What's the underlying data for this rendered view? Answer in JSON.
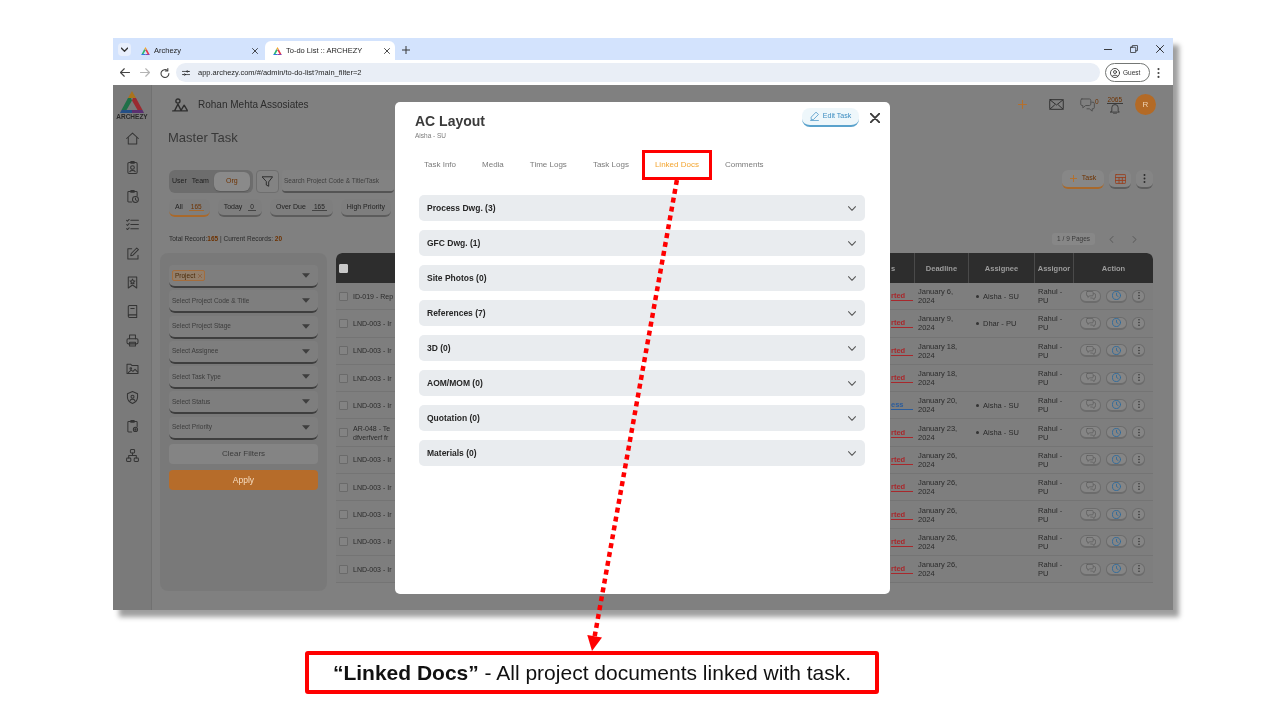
{
  "browser": {
    "tabs": [
      {
        "title": "Archezy",
        "selected": false
      },
      {
        "title": "To-do List :: ARCHEZY",
        "selected": true
      }
    ],
    "url": "app.archezy.com/#/admin/to-do-list?main_filter=2",
    "profile": "Guest"
  },
  "app": {
    "brand": "ARCHEZY",
    "company": "Rohan Mehta Assosiates",
    "chat_count": "0",
    "notification_count": "2065",
    "avatar": "R",
    "page_title": "Master Task",
    "scope": [
      {
        "label": "User",
        "selected": false
      },
      {
        "label": "Team",
        "selected": false
      },
      {
        "label": "Org",
        "selected": true
      }
    ],
    "search": {
      "placeholder": "Search Project Code & Title/Task"
    },
    "add_task": "Task",
    "quick_filters": [
      {
        "label": "All",
        "count": "165",
        "selected": true
      },
      {
        "label": "Today",
        "count": "0",
        "selected": false
      },
      {
        "label": "Over Due",
        "count": "165",
        "selected": false
      },
      {
        "label": "High Priority",
        "selected": false
      }
    ],
    "summary": {
      "total_label": "Total Record:",
      "total": "165",
      "current_label": "| Current Records:",
      "current": "20"
    },
    "pagination": "1 / 9 Pages",
    "filters": {
      "fields": [
        {
          "kind": "tags",
          "tags": [
            "Project"
          ]
        },
        {
          "kind": "select",
          "placeholder": "Select Project Code & Title"
        },
        {
          "kind": "select",
          "placeholder": "Select Project Stage"
        },
        {
          "kind": "select",
          "placeholder": "Select Assignee"
        },
        {
          "kind": "select",
          "placeholder": "Select Task Type"
        },
        {
          "kind": "select",
          "placeholder": "Select Status"
        },
        {
          "kind": "select",
          "placeholder": "Select Priority"
        }
      ],
      "clear": "Clear Filters",
      "apply": "Apply"
    },
    "table": {
      "select_all": {
        "checked": false
      },
      "columns": [
        "s",
        "Deadline",
        "Assignee",
        "Assignor",
        "Action"
      ],
      "rows": [
        {
          "checked": false,
          "title": "ID-019 - Rep",
          "status": {
            "text": "rted",
            "color": "#a8282c"
          },
          "deadline": "January 6, 2024",
          "assignees": [
            "Aisha - SU"
          ],
          "assignor": "Rahul - PU"
        },
        {
          "checked": false,
          "title": "LND-003 - Ir",
          "status": {
            "text": "rted",
            "color": "#a8282c"
          },
          "deadline": "January 9, 2024",
          "assignees": [
            "Dhar - PU"
          ],
          "assignor": "Rahul - PU"
        },
        {
          "checked": false,
          "title": "LND-003 - Ir",
          "status": {
            "text": "rted",
            "color": "#a8282c"
          },
          "deadline": "January 18, 2024",
          "assignor": "Rahul - PU"
        },
        {
          "checked": false,
          "title": "LND-003 - Ir",
          "status": {
            "text": "rted",
            "color": "#a8282c"
          },
          "deadline": "January 18, 2024",
          "assignor": "Rahul - PU"
        },
        {
          "checked": false,
          "title": "LND-003 - Ir",
          "status": {
            "text": "ess",
            "color": "#2a5c9c"
          },
          "deadline": "January 20, 2024",
          "assignees": [
            "Aisha - SU"
          ],
          "assignor": "Rahul - PU"
        },
        {
          "checked": false,
          "title": "AR-048 - Te dfverfverf fr",
          "status": {
            "text": "rted",
            "color": "#a8282c"
          },
          "deadline": "January 23, 2024",
          "assignees": [
            "Aisha - SU"
          ],
          "assignor": "Rahul - PU"
        },
        {
          "checked": false,
          "title": "LND-003 - Ir",
          "status": {
            "text": "rted",
            "color": "#a8282c"
          },
          "deadline": "January 26, 2024",
          "assignor": "Rahul - PU"
        },
        {
          "checked": false,
          "title": "LND-003 - Ir",
          "status": {
            "text": "rted",
            "color": "#a8282c"
          },
          "deadline": "January 26, 2024",
          "assignor": "Rahul - PU"
        },
        {
          "checked": false,
          "title": "LND-003 - Ir",
          "status": {
            "text": "rted",
            "color": "#a8282c"
          },
          "deadline": "January 26, 2024",
          "assignor": "Rahul - PU"
        },
        {
          "checked": false,
          "title": "LND-003 - Ir",
          "status": {
            "text": "rted",
            "color": "#a8282c"
          },
          "deadline": "January 26, 2024",
          "assignor": "Rahul - PU"
        },
        {
          "checked": false,
          "title": "LND-003 - Ir",
          "status": {
            "text": "rted",
            "color": "#a8282c"
          },
          "deadline": "January 26, 2024",
          "assignor": "Rahul - PU"
        }
      ]
    }
  },
  "modal": {
    "title": "AC Layout",
    "subtitle": "Aisha - SU",
    "edit_label": "Edit Task",
    "tabs": [
      {
        "label": "Task Info",
        "selected": false,
        "highlighted": false
      },
      {
        "label": "Media",
        "selected": false,
        "highlighted": false
      },
      {
        "label": "Time Logs",
        "selected": false,
        "highlighted": false
      },
      {
        "label": "Task Logs",
        "selected": false,
        "highlighted": false
      },
      {
        "label": "Linked Docs",
        "selected": true,
        "highlighted": true
      },
      {
        "label": "Comments",
        "selected": false,
        "highlighted": false
      }
    ],
    "sections": [
      {
        "label": "Process Dwg. (3)",
        "expanded": false
      },
      {
        "label": "GFC Dwg. (1)",
        "expanded": false
      },
      {
        "label": "Site Photos (0)",
        "expanded": false
      },
      {
        "label": "References (7)",
        "expanded": false
      },
      {
        "label": "3D (0)",
        "expanded": false
      },
      {
        "label": "AOM/MOM (0)",
        "expanded": false
      },
      {
        "label": "Quotation (0)",
        "expanded": false
      },
      {
        "label": "Materials (0)",
        "expanded": false
      }
    ]
  },
  "callout": "**“Linked Docs”** - All project documents linked with task."
}
